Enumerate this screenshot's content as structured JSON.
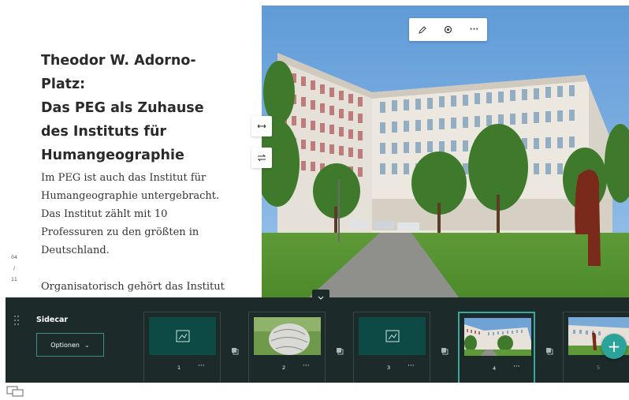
{
  "narrative": {
    "heading_lines": [
      "Theodor W. Adorno-",
      "Platz:",
      "Das PEG als Zuhause",
      "des Instituts für",
      "Humangeographie"
    ],
    "paragraph1_lines": [
      "Im PEG ist auch das Institut für",
      "Humangeographie untergebracht.",
      "Das Institut zählt mit 10",
      "Professuren zu den größten in",
      "Deutschland."
    ],
    "paragraph2_lines": [
      "Organisatorisch gehört das Institut"
    ],
    "page_counter": {
      "current": "04",
      "separator": "/",
      "total": "11"
    }
  },
  "photo_toolbar": {
    "icons": [
      "pencil-icon",
      "gear-icon",
      "more-icon"
    ],
    "more_label": "···"
  },
  "side_controls": {
    "expand_icon": "arrows-horizontal-icon",
    "swap_icon": "swap-icon"
  },
  "tray": {
    "title": "Sidecar",
    "options_label": "Optionen",
    "options_chevron": "⌄",
    "slides": [
      {
        "number": "1",
        "kind": "map",
        "more": "···"
      },
      {
        "number": "2",
        "kind": "sculpture",
        "more": "···"
      },
      {
        "number": "3",
        "kind": "map",
        "more": "···"
      },
      {
        "number": "4",
        "kind": "building",
        "more": "···",
        "active": true
      },
      {
        "number": "5",
        "kind": "building",
        "more": "···"
      }
    ],
    "add_label": "+"
  },
  "colors": {
    "tray_bg": "#1d2a2a",
    "accent": "#2ba39a",
    "map_thumb": "#0d4a45"
  }
}
